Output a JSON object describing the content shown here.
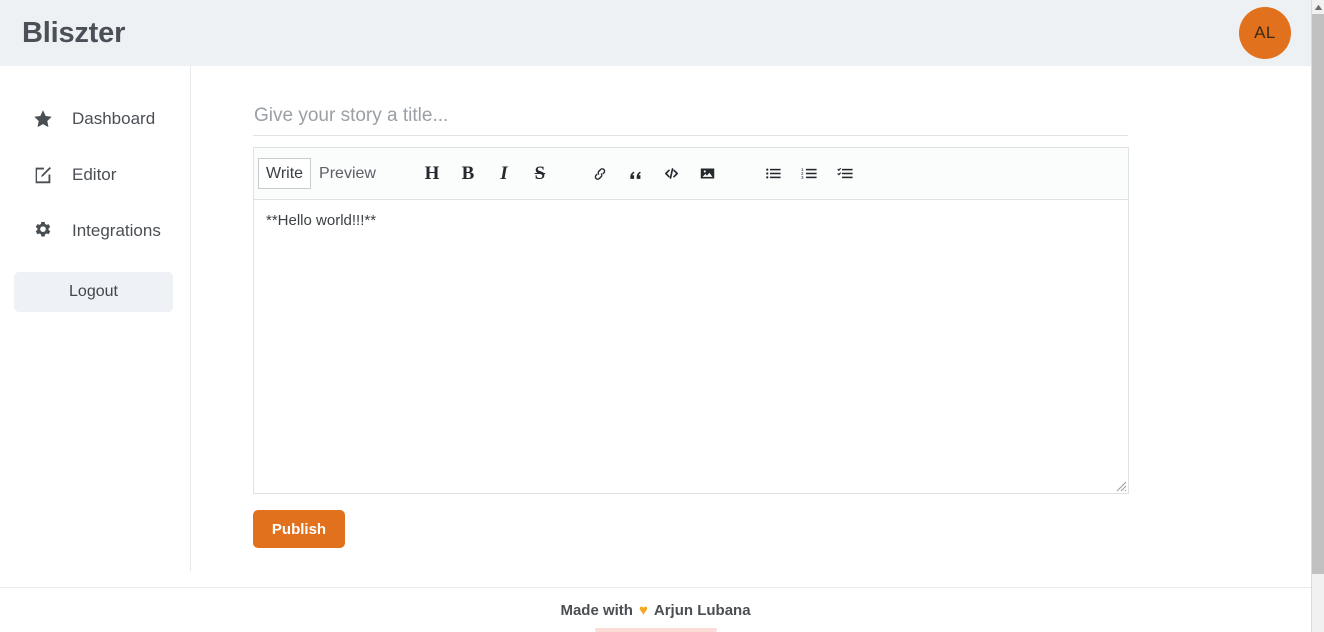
{
  "header": {
    "brand": "Bliszter",
    "avatar_initials": "AL",
    "avatar_color": "#e2711d",
    "background": "#edf1f4"
  },
  "sidebar": {
    "items": [
      {
        "label": "Dashboard",
        "icon": "star-icon"
      },
      {
        "label": "Editor",
        "icon": "edit-square-icon"
      },
      {
        "label": "Integrations",
        "icon": "gear-icon"
      }
    ],
    "logout_label": "Logout"
  },
  "editor": {
    "title_placeholder": "Give your story a title...",
    "title_value": "",
    "tabs": [
      {
        "label": "Write",
        "active": true
      },
      {
        "label": "Preview",
        "active": false
      }
    ],
    "tools": [
      {
        "name": "heading-icon",
        "glyph": "H"
      },
      {
        "name": "bold-icon",
        "glyph": "B"
      },
      {
        "name": "italic-icon",
        "glyph": "I"
      },
      {
        "name": "strikethrough-icon",
        "glyph": "S"
      },
      {
        "name": "link-icon"
      },
      {
        "name": "quote-icon"
      },
      {
        "name": "code-icon"
      },
      {
        "name": "image-icon"
      },
      {
        "name": "unordered-list-icon"
      },
      {
        "name": "ordered-list-icon"
      },
      {
        "name": "checklist-icon"
      }
    ],
    "content": "**Hello world!!!**",
    "publish_label": "Publish",
    "publish_color": "#e2711d"
  },
  "footer": {
    "made_with": "Made with",
    "heart": "♥",
    "author": "Arjun Lubana"
  }
}
